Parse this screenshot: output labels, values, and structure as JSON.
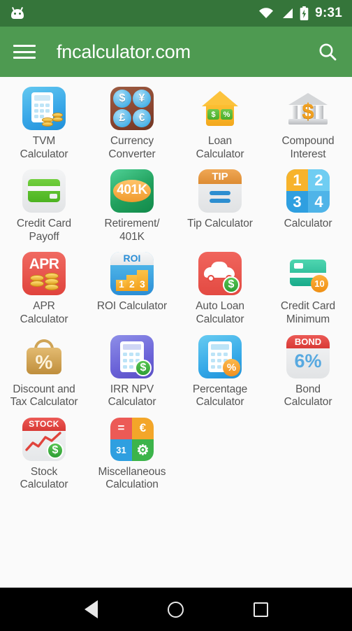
{
  "status_bar": {
    "icons": [
      "android-head-icon",
      "wifi-icon",
      "cell-signal-icon",
      "battery-charging-icon"
    ],
    "time": "9:31",
    "background": "#35753a"
  },
  "app_bar": {
    "menu_icon": "hamburger-menu-icon",
    "title": "fncalculator.com",
    "search_icon": "search-icon",
    "background": "#4e9a51"
  },
  "grid": {
    "columns": 4,
    "items": [
      {
        "label": "TVM\nCalculator",
        "line1": "TVM",
        "line2": "Calculator",
        "icon": "tvm-calculator-icon"
      },
      {
        "label": "Currency\nConverter",
        "line1": "Currency",
        "line2": "Converter",
        "icon": "currency-converter-icon",
        "symbols": [
          "$",
          "¥",
          "£",
          "€"
        ]
      },
      {
        "label": "Loan\nCalculator",
        "line1": "Loan",
        "line2": "Calculator",
        "icon": "loan-calculator-icon",
        "chips": [
          "$",
          "%"
        ]
      },
      {
        "label": "Compound\nInterest",
        "line1": "Compound",
        "line2": "Interest",
        "icon": "compound-interest-icon",
        "symbol": "$"
      },
      {
        "label": "Credit Card\nPayoff",
        "line1": "Credit Card",
        "line2": "Payoff",
        "icon": "credit-card-payoff-icon"
      },
      {
        "label": "Retirement/\n401K",
        "line1": "Retirement/",
        "line2": "401K",
        "icon": "retirement-401k-icon",
        "badge": "401K"
      },
      {
        "label": "Tip Calculator",
        "line1": "Tip Calculator",
        "line2": "",
        "icon": "tip-calculator-icon",
        "badge": "TIP"
      },
      {
        "label": "Calculator",
        "line1": "Calculator",
        "line2": "",
        "icon": "calculator-icon",
        "digits": [
          "1",
          "2",
          "3",
          "4"
        ]
      },
      {
        "label": "APR\nCalculator",
        "line1": "APR",
        "line2": "Calculator",
        "icon": "apr-calculator-icon",
        "badge": "APR"
      },
      {
        "label": "ROI Calculator",
        "line1": "ROI Calculator",
        "line2": "",
        "icon": "roi-calculator-icon",
        "badge": "ROI",
        "digits": [
          "1",
          "2",
          "3"
        ]
      },
      {
        "label": "Auto Loan\nCalculator",
        "line1": "Auto Loan",
        "line2": "Calculator",
        "icon": "auto-loan-calculator-icon",
        "badge": "$"
      },
      {
        "label": "Credit Card\nMinimum",
        "line1": "Credit Card",
        "line2": "Minimum",
        "icon": "credit-card-minimum-icon",
        "badge": "10"
      },
      {
        "label": "Discount and\nTax Calculator",
        "line1": "Discount and",
        "line2": "Tax Calculator",
        "icon": "discount-tax-calculator-icon",
        "badge": "%"
      },
      {
        "label": "IRR NPV\nCalculator",
        "line1": "IRR NPV",
        "line2": "Calculator",
        "icon": "irr-npv-calculator-icon",
        "badge": "$"
      },
      {
        "label": "Percentage\nCalculator",
        "line1": "Percentage",
        "line2": "Calculator",
        "icon": "percentage-calculator-icon",
        "badge": "%"
      },
      {
        "label": "Bond\nCalculator",
        "line1": "Bond",
        "line2": "Calculator",
        "icon": "bond-calculator-icon",
        "badge": "BOND",
        "rate": "6%"
      },
      {
        "label": "Stock\nCalculator",
        "line1": "Stock",
        "line2": "Calculator",
        "icon": "stock-calculator-icon",
        "badge": "STOCK",
        "symbol": "$"
      },
      {
        "label": "Miscellaneous\nCalculation",
        "line1": "Miscellaneous",
        "line2": "Calculation",
        "icon": "miscellaneous-calculation-icon",
        "tiles": [
          "=",
          "€",
          "31",
          "⚙"
        ]
      }
    ]
  },
  "nav_bar": {
    "back": "back-icon",
    "home": "home-icon",
    "recents": "recents-icon",
    "background": "#000000"
  }
}
